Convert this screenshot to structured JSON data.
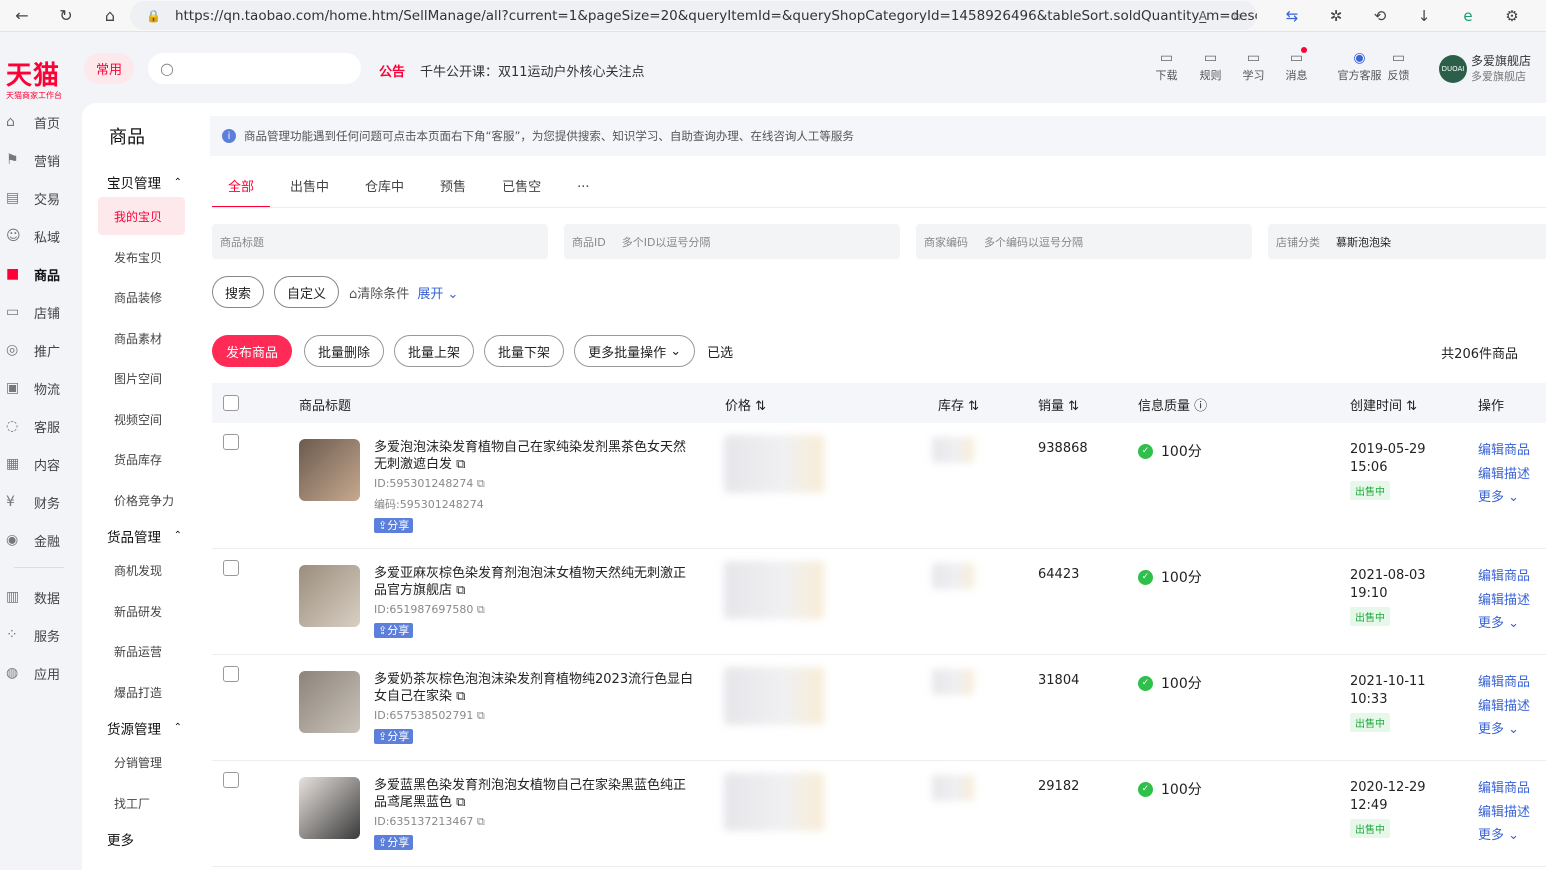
{
  "browser": {
    "url": "https://qn.taobao.com/home.htm/SellManage/all?current=1&pageSize=20&queryItemId=&queryShopCategoryId=1458926496&tableSort.soldQuantity_m=desc"
  },
  "header": {
    "logo": "天猫",
    "logo_sub": "天猫商家工作台",
    "changyong": "常用",
    "notice_tag": "公告",
    "notice": "千牛公开课：双11运动户外核心关注点",
    "tools": [
      {
        "label": "下载",
        "icon": "download-icon"
      },
      {
        "label": "规则",
        "icon": "rules-icon"
      },
      {
        "label": "学习",
        "icon": "learn-icon"
      },
      {
        "label": "消息",
        "icon": "message-icon"
      },
      {
        "label": "官方客服",
        "icon": "support-icon"
      },
      {
        "label": "反馈",
        "icon": "feedback-icon"
      }
    ],
    "avatar_text": "DUOAI",
    "shop_name": "多爱旗舰店",
    "shop_sub": "多爱旗舰店"
  },
  "rail": {
    "items": [
      "首页",
      "营销",
      "交易",
      "私域",
      "商品",
      "店铺",
      "推广",
      "物流",
      "客服",
      "内容",
      "财务",
      "金融"
    ],
    "items2": [
      "数据",
      "服务",
      "应用"
    ]
  },
  "subnav": {
    "title": "商品",
    "group1": "宝贝管理",
    "group1_items": [
      "我的宝贝",
      "发布宝贝",
      "商品装修",
      "商品素材",
      "图片空间",
      "视频空间",
      "货品库存",
      "价格竞争力"
    ],
    "group2": "货品管理",
    "group2_items": [
      "商机发现",
      "新品研发",
      "新品运营",
      "爆品打造"
    ],
    "group3": "货源管理",
    "group3_items": [
      "分销管理",
      "找工厂"
    ],
    "more": "更多"
  },
  "main": {
    "info": "商品管理功能遇到任何问题可点击本页面右下角“客服”，为您提供搜索、知识学习、自助查询办理、在线咨询人工等服务",
    "tabs": [
      "全部",
      "出售中",
      "仓库中",
      "预售",
      "已售空",
      "···"
    ],
    "filters": {
      "title_placeholder": "商品标题",
      "id_label": "商品ID",
      "id_placeholder": "多个ID以逗号分隔",
      "code_label": "商家编码",
      "code_placeholder": "多个编码以逗号分隔",
      "cat_label": "店铺分类",
      "cat_value": "慕斯泡泡染"
    },
    "search_btn": "搜索",
    "custom_btn": "自定义",
    "clear": "清除条件",
    "expand": "展开",
    "actions": {
      "publish": "发布商品",
      "batch_delete": "批量删除",
      "batch_up": "批量上架",
      "batch_down": "批量下架",
      "more_batch": "更多批量操作",
      "selected": "已选",
      "total": "共206件商品"
    },
    "columns": [
      "商品标题",
      "价格",
      "库存",
      "销量",
      "信息质量",
      "创建时间",
      "操作"
    ],
    "rows": [
      {
        "title": "多爱泡泡沫染发育植物自己在家纯染发剂黑茶色女天然无刺激遮白发",
        "id": "ID:595301248274",
        "code": "编码:595301248274",
        "share": "分享",
        "sales": "938868",
        "score": "100分",
        "time": "2019-05-29 15:06",
        "status": "出售中"
      },
      {
        "title": "多爱亚麻灰棕色染发育剂泡泡沫女植物天然纯无刺激正品官方旗舰店",
        "id": "ID:651987697580",
        "code": "",
        "share": "分享",
        "sales": "64423",
        "score": "100分",
        "time": "2021-08-03 19:10",
        "status": "出售中"
      },
      {
        "title": "多爱奶茶灰棕色泡泡沫染发剂育植物纯2023流行色显白女自己在家染",
        "id": "ID:657538502791",
        "code": "",
        "share": "分享",
        "sales": "31804",
        "score": "100分",
        "time": "2021-10-11 10:33",
        "status": "出售中"
      },
      {
        "title": "多爱蓝黑色染发育剂泡泡女植物自己在家染黑蓝色纯正品鸢尾黑蓝色",
        "id": "ID:635137213467",
        "code": "",
        "share": "分享",
        "sales": "29182",
        "score": "100分",
        "time": "2020-12-29 12:49",
        "status": "出售中"
      }
    ],
    "ops": {
      "edit": "编辑商品",
      "desc": "编辑描述",
      "more": "更多"
    }
  },
  "colors": {
    "brand": "#ff0036",
    "link": "#3963d6",
    "ok": "#2fbf4b"
  }
}
